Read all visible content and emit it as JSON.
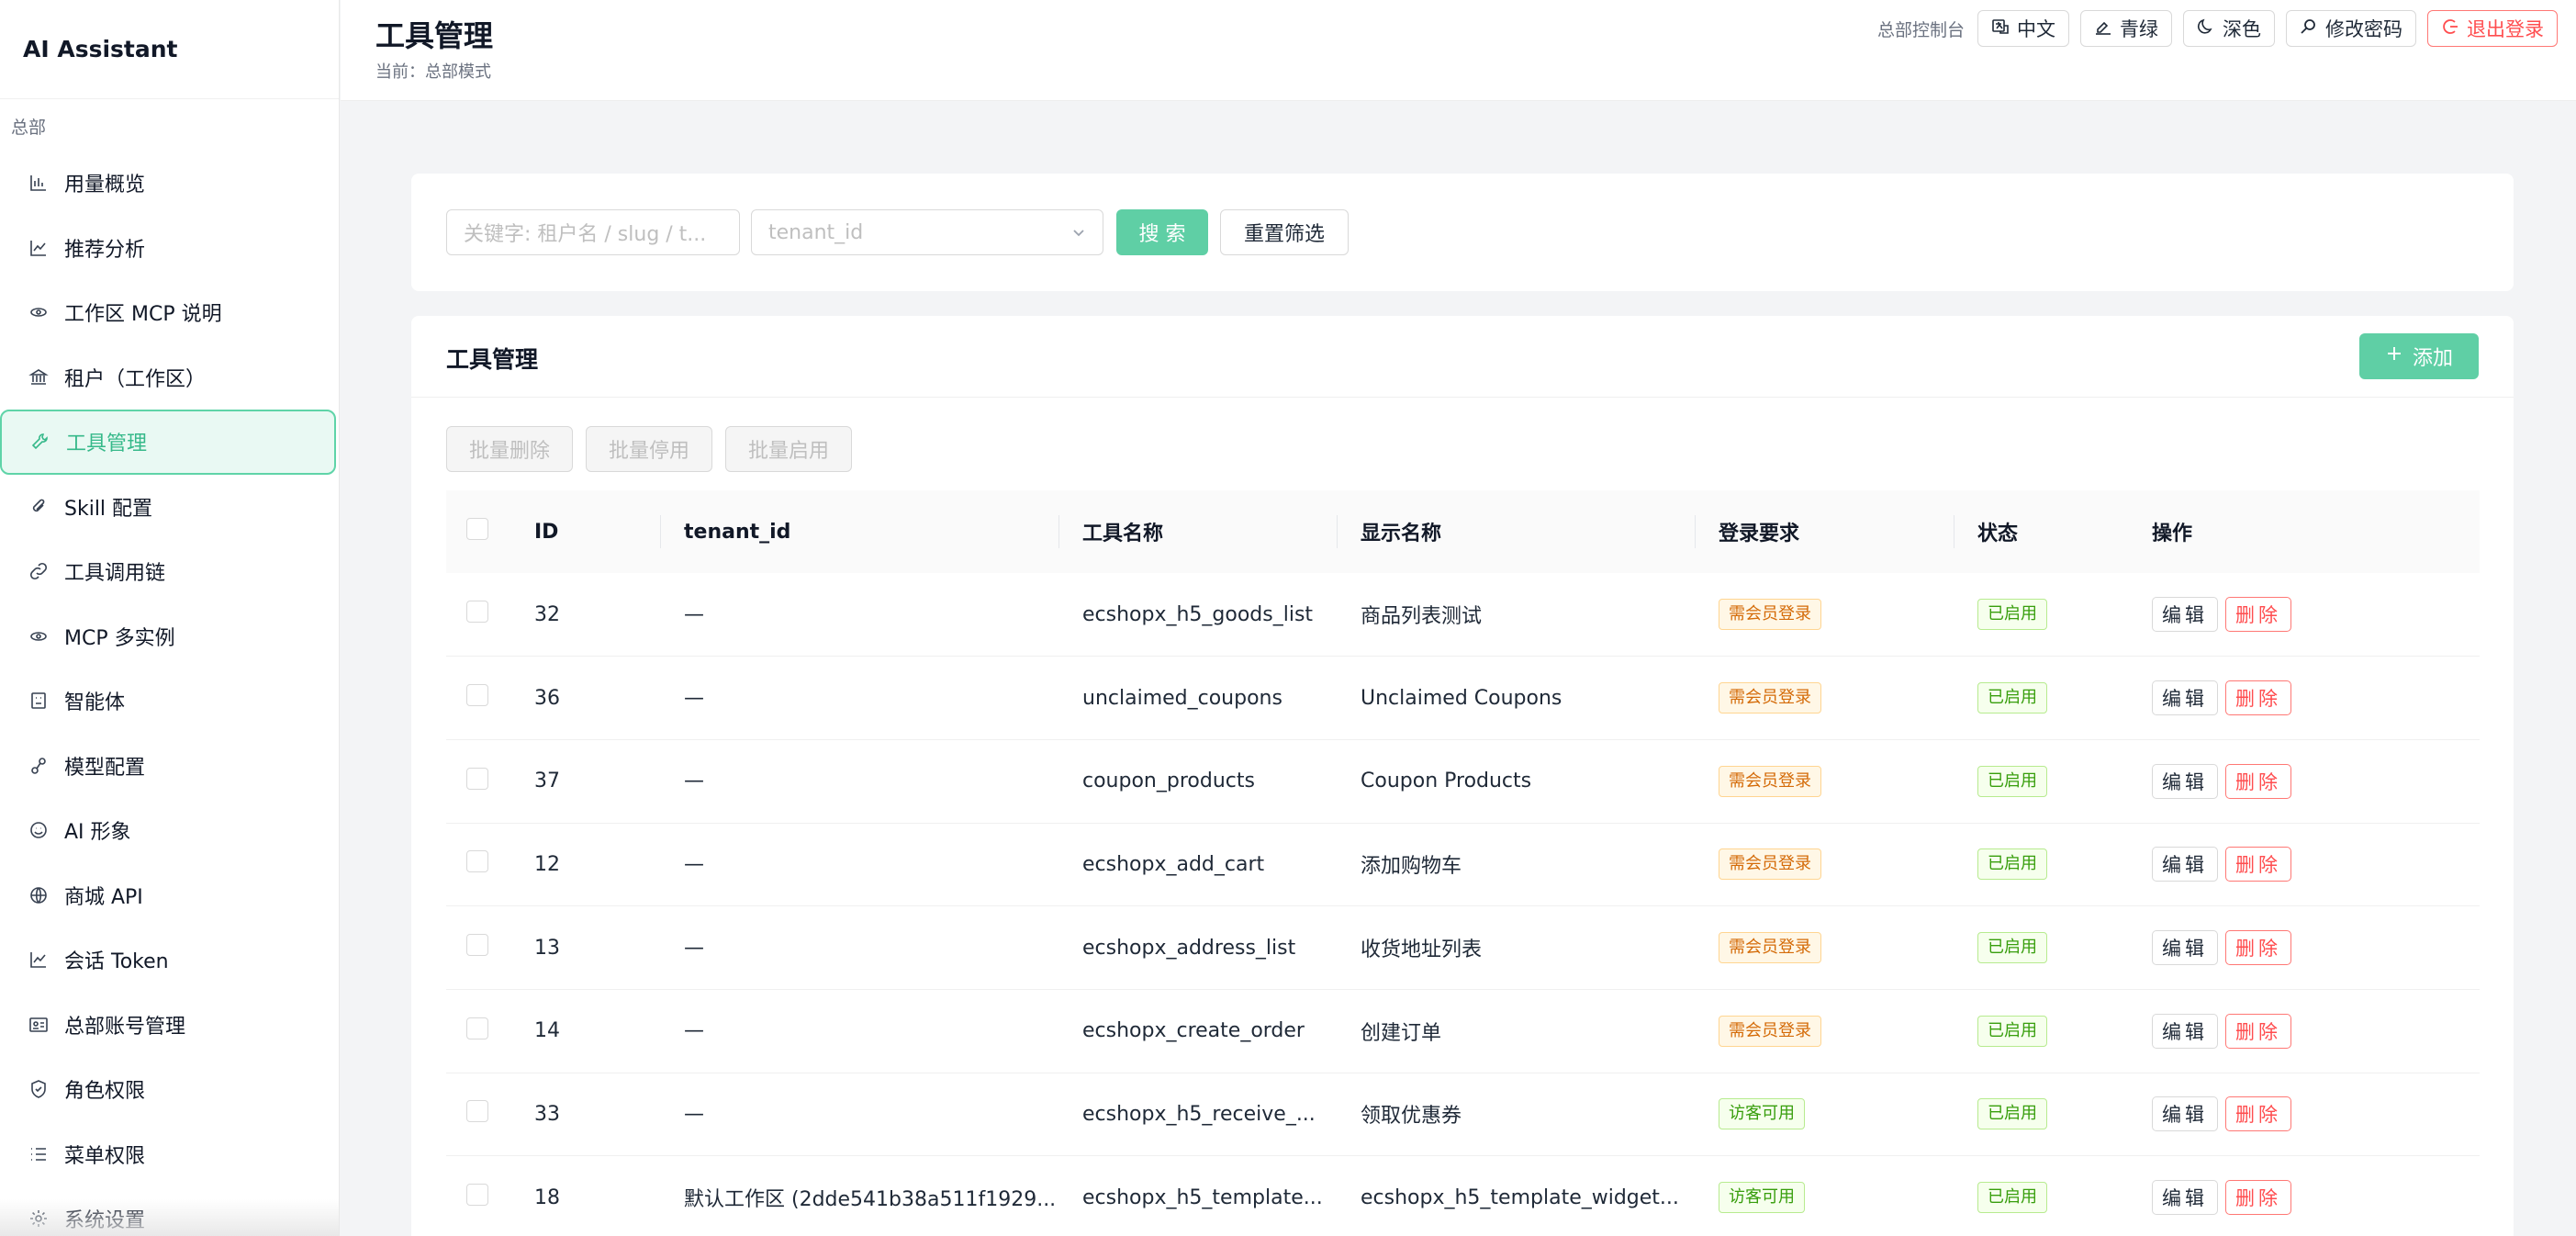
{
  "app": {
    "title": "AI Assistant"
  },
  "sidebar": {
    "section": "总部",
    "items": [
      {
        "label": "用量概览",
        "icon": "bar-chart-icon"
      },
      {
        "label": "推荐分析",
        "icon": "line-chart-icon"
      },
      {
        "label": "工作区 MCP 说明",
        "icon": "api-icon"
      },
      {
        "label": "租户（工作区）",
        "icon": "bank-icon"
      },
      {
        "label": "工具管理",
        "icon": "tool-icon",
        "active": true
      },
      {
        "label": "Skill 配置",
        "icon": "paperclip-icon"
      },
      {
        "label": "工具调用链",
        "icon": "link-icon"
      },
      {
        "label": "MCP 多实例",
        "icon": "api-icon"
      },
      {
        "label": "智能体",
        "icon": "robot-icon"
      },
      {
        "label": "模型配置",
        "icon": "model-icon"
      },
      {
        "label": "AI 形象",
        "icon": "smile-icon"
      },
      {
        "label": "商城 API",
        "icon": "globe-icon"
      },
      {
        "label": "会话 Token",
        "icon": "line-chart-icon"
      },
      {
        "label": "总部账号管理",
        "icon": "idcard-icon"
      },
      {
        "label": "角色权限",
        "icon": "shield-icon"
      },
      {
        "label": "菜单权限",
        "icon": "list-icon"
      },
      {
        "label": "系统设置",
        "icon": "gear-icon"
      }
    ]
  },
  "header": {
    "title": "工具管理",
    "subtitle": "当前：总部模式",
    "console": "总部控制台",
    "lang": "中文",
    "theme": "青绿",
    "dark": "深色",
    "password": "修改密码",
    "logout": "退出登录"
  },
  "filter": {
    "keyword_placeholder": "关键字: 租户名 / slug / t...",
    "tenant_placeholder": "tenant_id",
    "search": "搜 索",
    "reset": "重置筛选"
  },
  "table_card": {
    "title": "工具管理",
    "add": "添加",
    "batch_delete": "批量删除",
    "batch_disable": "批量停用",
    "batch_enable": "批量启用",
    "columns": [
      "ID",
      "tenant_id",
      "工具名称",
      "显示名称",
      "登录要求",
      "状态",
      "操作"
    ],
    "edit": "编辑",
    "delete": "删除",
    "rows": [
      {
        "id": "32",
        "tenant": "—",
        "tool": "ecshopx_h5_goods_list",
        "display": "商品列表测试",
        "login": "需会员登录",
        "login_type": "orange",
        "status": "已启用"
      },
      {
        "id": "36",
        "tenant": "—",
        "tool": "unclaimed_coupons",
        "display": "Unclaimed Coupons",
        "login": "需会员登录",
        "login_type": "orange",
        "status": "已启用"
      },
      {
        "id": "37",
        "tenant": "—",
        "tool": "coupon_products",
        "display": "Coupon Products",
        "login": "需会员登录",
        "login_type": "orange",
        "status": "已启用"
      },
      {
        "id": "12",
        "tenant": "—",
        "tool": "ecshopx_add_cart",
        "display": "添加购物车",
        "login": "需会员登录",
        "login_type": "orange",
        "status": "已启用"
      },
      {
        "id": "13",
        "tenant": "—",
        "tool": "ecshopx_address_list",
        "display": "收货地址列表",
        "login": "需会员登录",
        "login_type": "orange",
        "status": "已启用"
      },
      {
        "id": "14",
        "tenant": "—",
        "tool": "ecshopx_create_order",
        "display": "创建订单",
        "login": "需会员登录",
        "login_type": "orange",
        "status": "已启用"
      },
      {
        "id": "33",
        "tenant": "—",
        "tool": "ecshopx_h5_receive_...",
        "display": "领取优惠券",
        "login": "访客可用",
        "login_type": "green",
        "status": "已启用"
      },
      {
        "id": "18",
        "tenant": "默认工作区 (2dde541b38a511f1929...",
        "tool": "ecshopx_h5_template...",
        "display": "ecshopx_h5_template_widget...",
        "login": "访客可用",
        "login_type": "green",
        "status": "已启用"
      }
    ]
  },
  "colors": {
    "accent": "#5fcfa5",
    "danger": "#ff4d4f"
  }
}
